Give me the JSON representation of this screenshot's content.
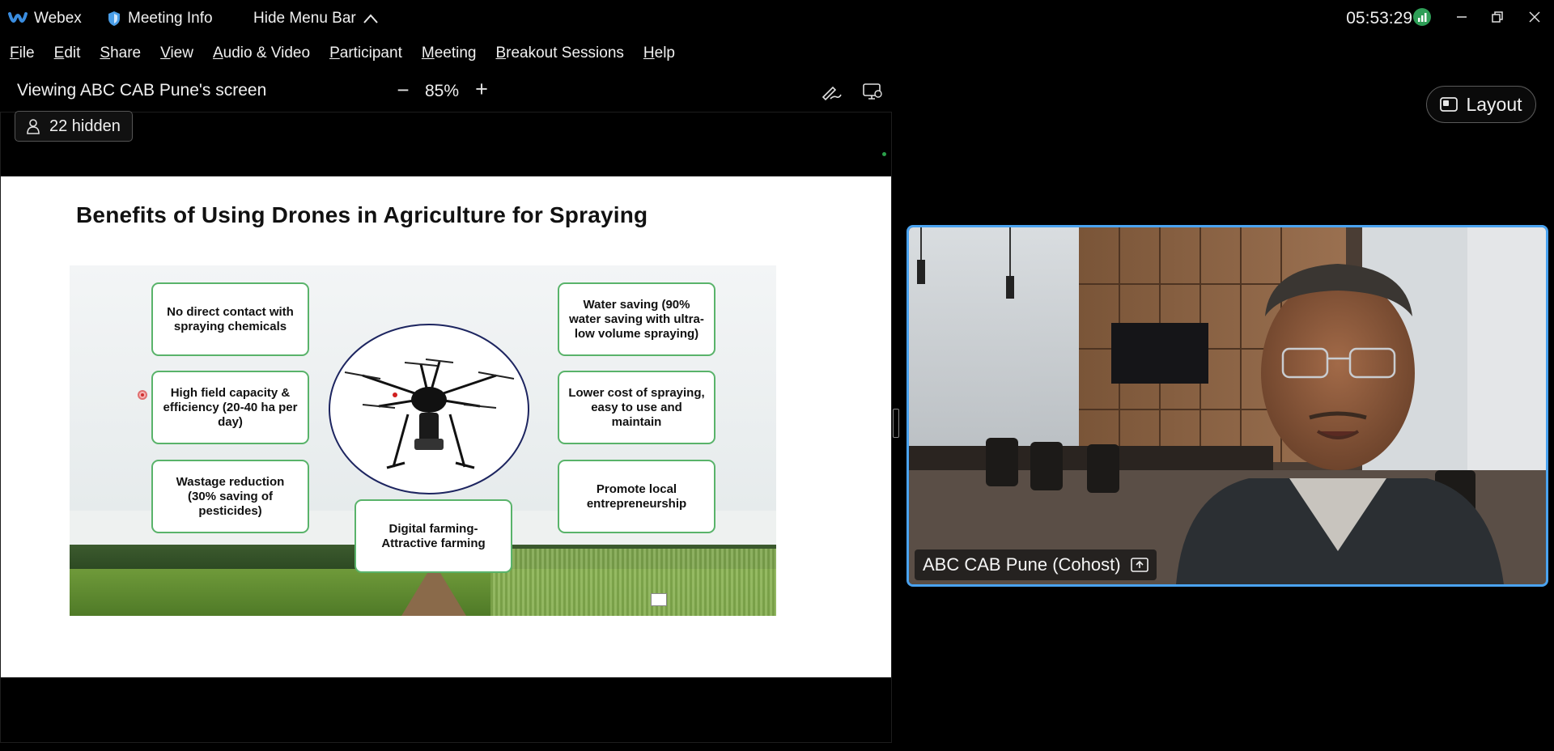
{
  "titlebar": {
    "app_name": "Webex",
    "meeting_info": "Meeting Info",
    "hide_menu": "Hide Menu Bar",
    "clock": "05:53:29"
  },
  "menu": {
    "items": [
      {
        "key": "F",
        "rest": "ile"
      },
      {
        "key": "E",
        "rest": "dit"
      },
      {
        "key": "S",
        "rest": "hare"
      },
      {
        "key": "V",
        "rest": "iew"
      },
      {
        "key": "A",
        "rest": "udio & Video"
      },
      {
        "key": "P",
        "rest": "articipant"
      },
      {
        "key": "M",
        "rest": "eeting"
      },
      {
        "key": "B",
        "rest": "reakout Sessions"
      },
      {
        "key": "H",
        "rest": "elp"
      }
    ]
  },
  "share": {
    "viewing": "Viewing ABC CAB Pune's screen",
    "zoom": "85%",
    "hidden_count": "22 hidden"
  },
  "slide": {
    "title": "Benefits of Using Drones in Agriculture for Spraying",
    "box_no_contact": "No direct contact with spraying chemicals",
    "box_field_capacity": "High field capacity & efficiency (20-40 ha per day)",
    "box_wastage": "Wastage reduction (30% saving of pesticides)",
    "box_digital": "Digital farming-Attractive farming",
    "box_water": "Water saving (90% water saving with ultra-low volume spraying)",
    "box_cost": "Lower cost of spraying, easy to use and maintain",
    "box_entrepreneurship": "Promote local entrepreneurship"
  },
  "layout_button": "Layout",
  "video": {
    "participant": "ABC CAB Pune (Cohost)"
  },
  "colors": {
    "accent": "#4aa3f0",
    "box_border": "#59b36a",
    "drone_circle": "#1d2560",
    "signal": "#2e9e57"
  }
}
